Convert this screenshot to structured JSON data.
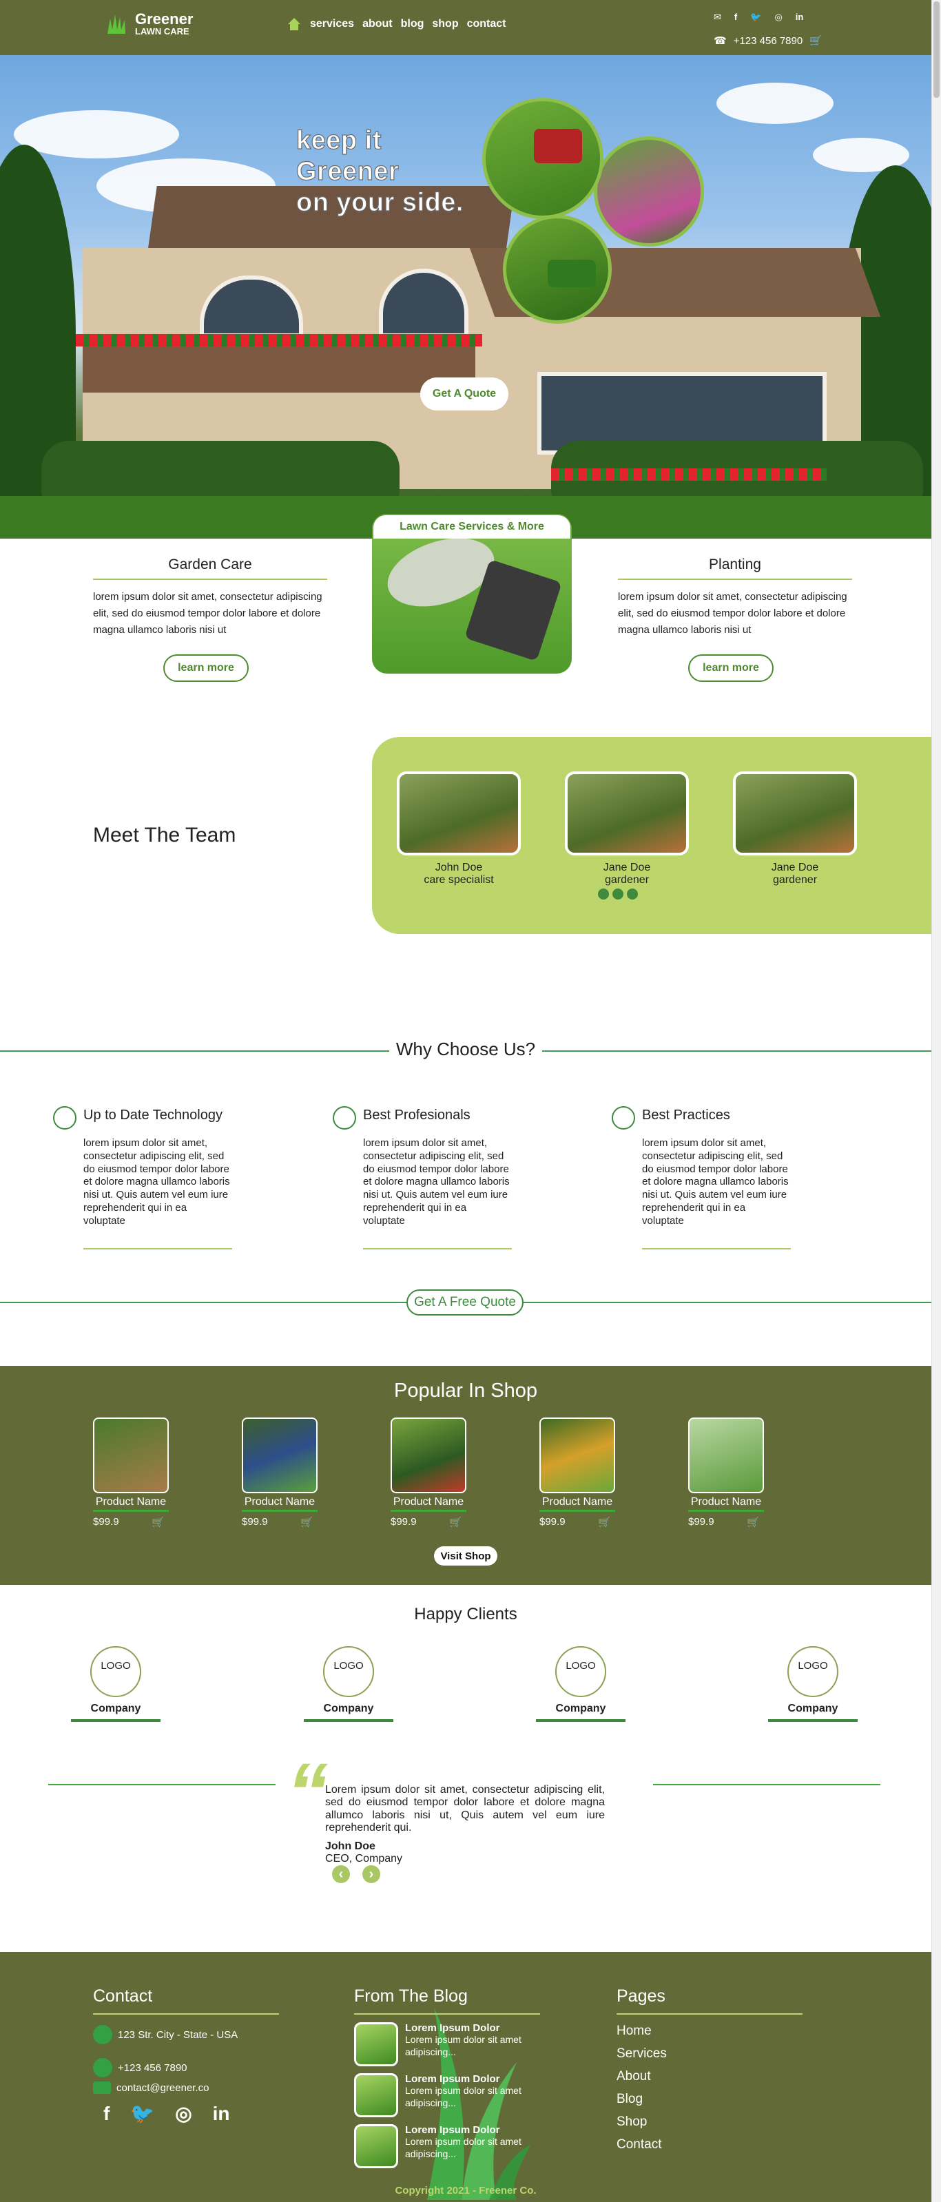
{
  "header": {
    "logo_name": "Greener",
    "logo_sub": "LAWN CARE",
    "nav": [
      "services",
      "about",
      "blog",
      "shop",
      "contact"
    ],
    "social_icons": [
      "mail-icon",
      "facebook-icon",
      "twitter-icon",
      "instagram-icon",
      "linkedin-icon"
    ],
    "phone": "+123 456 7890"
  },
  "hero": {
    "title_line1": "keep it",
    "title_line2": "Greener",
    "title_line3": "on your side.",
    "quote_button": "Get A Quote"
  },
  "services": {
    "left": {
      "title": "Garden Care",
      "text": "lorem ipsum dolor sit amet, consectetur adipiscing elit, sed do eiusmod tempor dolor labore et dolore magna ullamco laboris nisi ut",
      "button": "learn more"
    },
    "center": {
      "tab": "Lawn Care Services & More"
    },
    "right": {
      "title": "Planting",
      "text": "lorem ipsum dolor sit amet, consectetur adipiscing elit, sed do eiusmod tempor dolor labore et dolore magna ullamco laboris nisi ut",
      "button": "learn more"
    }
  },
  "team": {
    "title": "Meet The Team",
    "members": [
      {
        "name": "John Doe",
        "role": "care specialist"
      },
      {
        "name": "Jane Doe",
        "role": "gardener"
      },
      {
        "name": "Jane Doe",
        "role": "gardener"
      }
    ]
  },
  "why": {
    "title": "Why Choose Us?",
    "features": [
      {
        "title": "Up to Date Technology",
        "text": "lorem ipsum dolor sit amet, consectetur adipiscing elit, sed do eiusmod tempor dolor labore et dolore magna ullamco laboris nisi ut. Quis autem vel eum iure reprehenderit qui in ea voluptate"
      },
      {
        "title": "Best Profesionals",
        "text": "lorem ipsum dolor sit amet, consectetur adipiscing elit, sed do eiusmod tempor dolor labore et dolore magna ullamco laboris nisi ut. Quis autem vel eum iure reprehenderit qui in ea voluptate"
      },
      {
        "title": "Best Practices",
        "text": "lorem ipsum dolor sit amet, consectetur adipiscing elit, sed do eiusmod tempor dolor labore et dolore magna ullamco laboris nisi ut. Quis autem vel eum iure reprehenderit qui in ea voluptate"
      }
    ],
    "quote_button": "Get A Free Quote"
  },
  "shop": {
    "title": "Popular In Shop",
    "products": [
      {
        "name": "Product Name",
        "price": "$99.9"
      },
      {
        "name": "Product Name",
        "price": "$99.9"
      },
      {
        "name": "Product Name",
        "price": "$99.9"
      },
      {
        "name": "Product Name",
        "price": "$99.9"
      },
      {
        "name": "Product Name",
        "price": "$99.9"
      }
    ],
    "visit_button": "Visit Shop"
  },
  "clients": {
    "title": "Happy Clients",
    "items": [
      {
        "logo": "LOGO",
        "name": "Company"
      },
      {
        "logo": "LOGO",
        "name": "Company"
      },
      {
        "logo": "LOGO",
        "name": "Company"
      },
      {
        "logo": "LOGO",
        "name": "Company"
      }
    ],
    "testimonial": "Lorem ipsum dolor sit amet, consectetur adipiscing elit, sed do eiusmod tempor dolor labore et dolore magna allumco laboris nisi ut, Quis autem vel eum iure reprehenderit qui.",
    "author": "John Doe",
    "author_role": "CEO, Company"
  },
  "footer": {
    "contact_title": "Contact",
    "address": "123 Str. City - State - USA",
    "phone": "+123 456 7890",
    "email": "contact@greener.co",
    "blog_title": "From The Blog",
    "posts": [
      {
        "title": "Lorem Ipsum Dolor",
        "excerpt": "Lorem ipsum dolor sit amet adipiscing..."
      },
      {
        "title": "Lorem Ipsum Dolor",
        "excerpt": "Lorem ipsum dolor sit amet adipiscing..."
      },
      {
        "title": "Lorem Ipsum Dolor",
        "excerpt": "Lorem ipsum dolor sit amet adipiscing..."
      }
    ],
    "pages_title": "Pages",
    "pages": [
      "Home",
      "Services",
      "About",
      "Blog",
      "Shop",
      "Contact"
    ],
    "copyright": "Copyright 2021 - Freener Co."
  },
  "colors": {
    "olive": "#626b37",
    "lime": "#bcd66c",
    "green": "#3e8a3e"
  }
}
